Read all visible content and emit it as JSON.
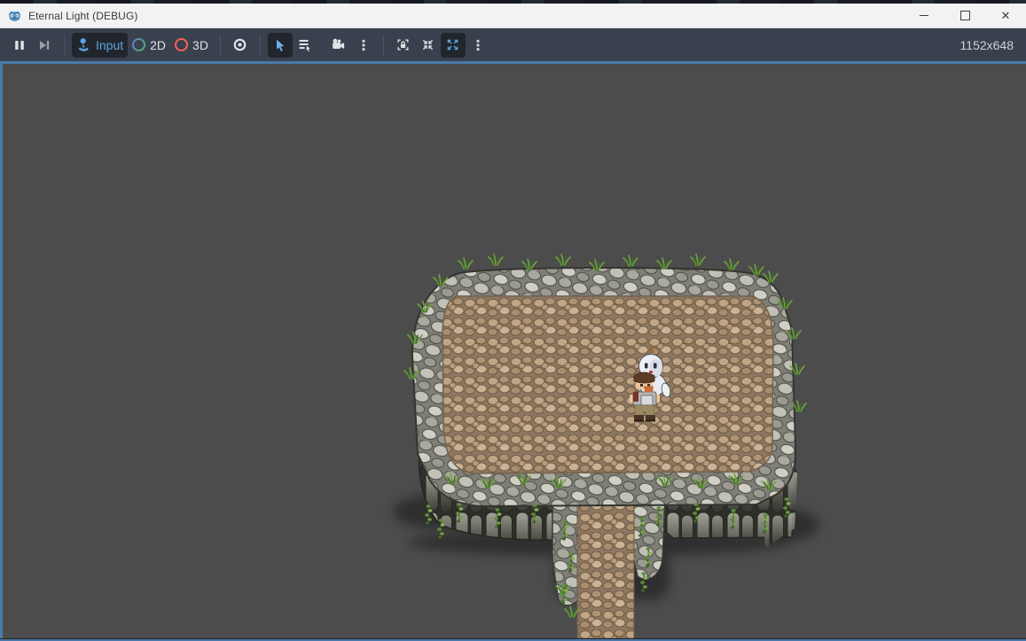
{
  "window": {
    "title": "Eternal Light (DEBUG)",
    "app_icon": "godot-icon",
    "control_icons": [
      "minimize-icon",
      "maximize-icon",
      "close-icon"
    ]
  },
  "toolbar": {
    "input_label": "Input",
    "mode_2d_label": "2D",
    "mode_3d_label": "3D",
    "resolution": "1152x648",
    "active_buttons": [
      "input-mode-button",
      "select-mode-button",
      "expand-window-button"
    ],
    "icons": {
      "pause": "pause-icon",
      "next_frame": "next-frame-icon",
      "input": "joystick-icon",
      "mode_2d": "green-ring-icon",
      "mode_3d": "red-ring-icon",
      "target": "circle-dot-icon",
      "select": "cursor-arrow-icon",
      "select_list": "list-cursor-icon",
      "camera_override": "camera-icon",
      "menu": "kebab-menu-icon",
      "embed": "frame-lock-icon",
      "shrink": "shrink-arrows-icon",
      "expand": "expand-arrows-icon"
    }
  },
  "viewport": {
    "scene": "rocky-plateau-with-cobblestone-path",
    "entities": [
      "player-character",
      "ghost-companion"
    ]
  },
  "colors": {
    "accent": "#5fa3e0",
    "titlebar_bg": "#f2f2f2",
    "titlebar_text": "#3c3c3c",
    "toolbar_bg": "#3a414e",
    "toolbar_active_bg": "#21262d",
    "toolbar_icon": "#e0e4e9",
    "toolbar_icon_dim": "#99a0aa",
    "separator": "#4c5462",
    "resolution_text": "#ccd2d9",
    "ring_3d": "#ff5f56",
    "focus_border": "#4a79ab",
    "viewport_bg": "#4c4c4c",
    "cobble_stone": "#b49b7f",
    "rock_light": "#c1c1b7",
    "cliff_dark": "#55544d",
    "grass_green": "#6fa23e",
    "godot_blue": "#478cbf"
  }
}
